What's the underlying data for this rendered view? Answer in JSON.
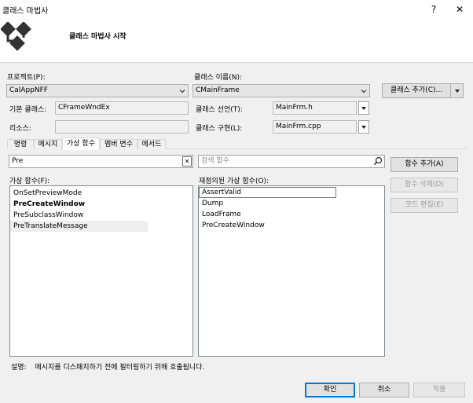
{
  "window": {
    "title": "클래스 마법사",
    "help_glyph": "?",
    "close_glyph": "✕"
  },
  "header": {
    "wizard_title": "클래스 마법사 시작",
    "logo_icon": "class-wizard-logo-icon"
  },
  "project": {
    "label": "프로젝트(P):",
    "value": "CalAppNFF"
  },
  "class_name": {
    "label": "클래스 이름(N):",
    "value": "CMainFrame"
  },
  "add_class_button": {
    "label": "클래스 추가(C)..."
  },
  "base_class": {
    "label": "기본 클래스:",
    "value": "CFrameWndEx"
  },
  "class_decl": {
    "label": "클래스 선언(T):",
    "value": "MainFrm.h"
  },
  "resource": {
    "label": "리소스:",
    "value": ""
  },
  "class_impl": {
    "label": "클래스 구현(L):",
    "value": "MainFrm.cpp"
  },
  "tabs": [
    {
      "label": "명령"
    },
    {
      "label": "메시지"
    },
    {
      "label": "가상 함수"
    },
    {
      "label": "멤버 변수"
    },
    {
      "label": "메서드"
    }
  ],
  "filter": {
    "value": "Pre",
    "clear_glyph": "✕"
  },
  "search": {
    "placeholder": "검색 함수"
  },
  "virtual_functions": {
    "label": "가상 함수(F):",
    "items": [
      "OnSetPreviewMode",
      "PreCreateWindow",
      "PreSubclassWindow",
      "PreTranslateMessage"
    ]
  },
  "overridden_functions": {
    "label": "재정의된 가상 함수(O):",
    "items": [
      "AssertValid",
      "Dump",
      "LoadFrame",
      "PreCreateWindow"
    ]
  },
  "buttons": {
    "add_function": "함수 추가(A)",
    "delete_function": "함수 삭제(D)",
    "edit_code": "코드 편집(E)",
    "ok": "확인",
    "cancel": "취소",
    "apply": "적용"
  },
  "description": {
    "label": "설명:",
    "text": "메시지를 디스패치하기 전에 필터링하기 위해 호출됩니다."
  }
}
